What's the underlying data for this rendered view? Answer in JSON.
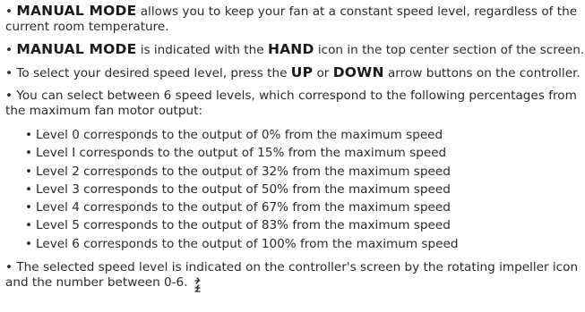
{
  "p1": {
    "bullet": "•",
    "kw": "MANUAL MODE",
    "text": " allows you to keep your fan at a constant speed level, regardless of the",
    "text2": "current room temperature."
  },
  "p2": {
    "bullet": "•",
    "kw": "MANUAL MODE",
    "text_a": " is indicated with the ",
    "kw2": "HAND",
    "text_b": " icon in the top center section of the screen.",
    "icon": "hand-icon"
  },
  "p3": {
    "bullet": "•",
    "text_a": " To select your desired speed level, press the ",
    "kw_up": "UP",
    "text_or": " or ",
    "kw_down": "DOWN",
    "text_b": " arrow buttons on the controller."
  },
  "p4": {
    "bullet": "•",
    "text": " You can select between 6 speed levels, which correspond to the following percentages from",
    "text2": "the maximum fan motor output:"
  },
  "levels": [
    "Level 0 corresponds to the output of 0% from the maximum speed",
    "Level I corresponds to the output of 15% from the maximum speed",
    "Level 2 corresponds to the output of 32% from the maximum speed",
    "Level 3 corresponds to the output of 50% from the maximum speed",
    "Level 4 corresponds to the output of 67% from the maximum speed",
    "Level 5 corresponds to the output of 83% from the maximum speed",
    "Level 6 corresponds to the output of 100% from the maximum speed"
  ],
  "level_bullet": "•",
  "p5": {
    "bullet": "•",
    "text": " The selected speed level is indicated on the controller's screen by the rotating impeller icon",
    "text2": "and the number between 0-6.",
    "icon": "impeller-icon"
  }
}
